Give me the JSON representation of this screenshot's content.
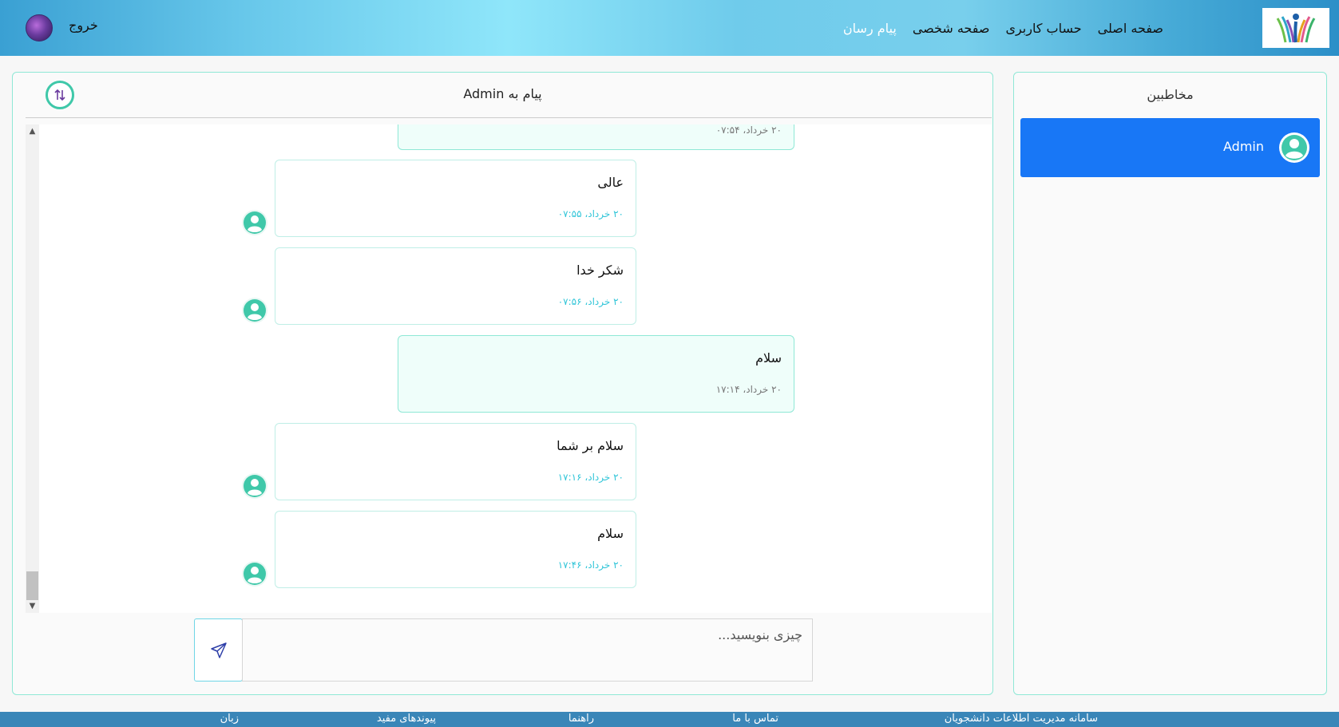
{
  "header": {
    "logo_icon": "people-reaching-logo",
    "nav": [
      {
        "label": "صفحه اصلی"
      },
      {
        "label": "حساب کاربری"
      },
      {
        "label": "صفحه شخصی"
      },
      {
        "label": "پیام رسان"
      }
    ],
    "logout_label": "خروج",
    "avatar_icon": "user-avatar"
  },
  "contacts": {
    "title": "مخاطبین",
    "items": [
      {
        "name": "Admin",
        "icon": "user-circle-icon"
      }
    ]
  },
  "chat": {
    "title": "پیام به Admin",
    "swap_icon": "swap-vertical-icon",
    "messages": [
      {
        "sender": "me",
        "text": "",
        "time": "۲۰ خرداد، ۰۷:۵۴"
      },
      {
        "sender": "them",
        "text": "عالی",
        "time": "۲۰ خرداد، ۰۷:۵۵"
      },
      {
        "sender": "them",
        "text": "شکر خدا",
        "time": "۲۰ خرداد، ۰۷:۵۶"
      },
      {
        "sender": "me",
        "text": "سلام",
        "time": "۲۰ خرداد، ۱۷:۱۴"
      },
      {
        "sender": "them",
        "text": "سلام بر شما",
        "time": "۲۰ خرداد، ۱۷:۱۶"
      },
      {
        "sender": "them",
        "text": "سلام",
        "time": "۲۰ خرداد، ۱۷:۴۶"
      }
    ],
    "composer": {
      "placeholder": "چیزی بنویسید...",
      "value": "",
      "send_icon": "send-icon"
    }
  },
  "footer": {
    "links": [
      {
        "label": "سامانه مدیریت اطلاعات دانشجویان"
      },
      {
        "label": "تماس با ما"
      },
      {
        "label": "راهنما"
      },
      {
        "label": "پیوندهای مفید"
      },
      {
        "label": "زبان"
      }
    ]
  },
  "colors": {
    "accent": "#1877f6",
    "teal": "#3fc8a9",
    "bubble_mine": "#effefa",
    "border": "#8fe8d6",
    "footer": "#3a86b8"
  }
}
